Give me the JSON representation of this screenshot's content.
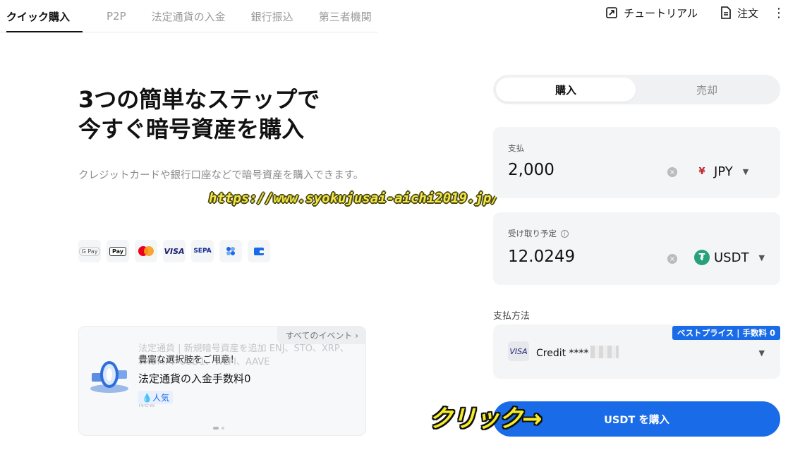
{
  "nav": {
    "tabs": [
      "クイック購入",
      "P2P",
      "法定通貨の入金",
      "銀行振込",
      "第三者機関"
    ],
    "tutorial": "チュートリアル",
    "orders": "注文",
    "more": "⋮"
  },
  "hero": {
    "title_line1": "3つの簡単なステップで",
    "title_line2": "今すぐ暗号資産を購入",
    "subtitle": "クレジットカードや銀行口座などで暗号資産を購入できます。"
  },
  "watermark": "https://www.syokujusai-aichi2019.jp/",
  "payment_icons": [
    {
      "icon": "google-pay-icon",
      "label": "G Pay"
    },
    {
      "icon": "apple-pay-icon",
      "label": "Pay"
    },
    {
      "icon": "mastercard-icon",
      "label": ""
    },
    {
      "icon": "visa-icon",
      "label": "VISA"
    },
    {
      "icon": "sepa-icon",
      "label": "SEPA"
    },
    {
      "icon": "bank-dots-icon",
      "label": ""
    },
    {
      "icon": "wallet-icon",
      "label": ""
    }
  ],
  "event": {
    "all_events": "すべてのイベント ›",
    "ghost_text": "法定通貨 | 新規暗号資産を追加 ENJ、STO、XRP、TRUMP、USD1、WLFI、AAVE",
    "ghost_tag": "New",
    "line1": "豊富な選択肢をご用意！",
    "line2": "法定通貨の入金手数料0",
    "tag": "人気"
  },
  "trade": {
    "buy_tab": "購入",
    "sell_tab": "売却",
    "pay_label": "支払",
    "pay_amount": "2,000",
    "pay_currency": "JPY",
    "pay_currency_symbol": "¥",
    "receive_label": "受け取り予定",
    "receive_amount": "12.0249",
    "receive_currency": "USDT",
    "receive_currency_symbol": "₮",
    "method_label": "支払方法",
    "badge": "ベストプライス | 手数料 0",
    "card_brand": "VISA",
    "card_text": "Credit ****",
    "buy_button": "USDT を購入"
  },
  "annotation": "クリック→",
  "colors": {
    "accent": "#1a6be8",
    "usdt": "#26a17b",
    "annotation": "#f5ec27"
  }
}
